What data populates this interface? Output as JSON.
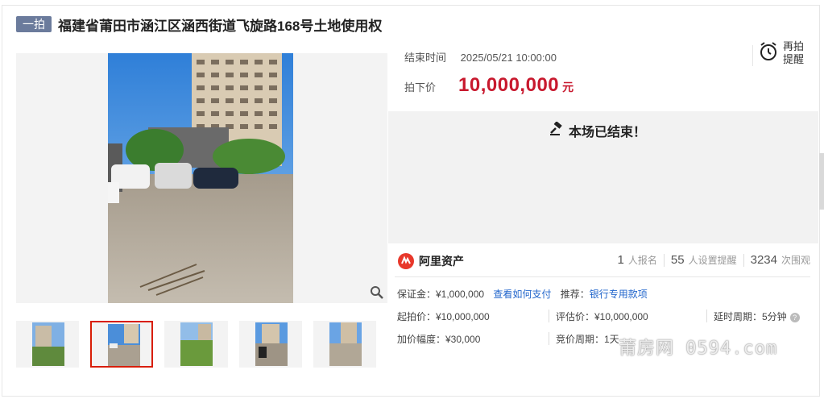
{
  "header": {
    "badge": "一拍",
    "title": "福建省莆田市涵江区涵西街道飞旋路168号土地使用权"
  },
  "auction": {
    "end_time_label": "结束时间",
    "end_time": "2025/05/21 10:00:00",
    "price_label": "拍下价",
    "price": "10,000,000",
    "price_unit": "元",
    "remind_line1": "再拍",
    "remind_line2": "提醒",
    "status": "本场已结束！"
  },
  "platform": {
    "name": "阿里资产",
    "signups": "1",
    "signups_label": "人报名",
    "reminders": "55",
    "reminders_label": "人设置提醒",
    "views": "3234",
    "views_label": "次围观"
  },
  "details": {
    "deposit": "保证金：¥1,000,000",
    "payment_link": "查看如何支付",
    "recommend_label": "推荐：",
    "recommend_link": "银行专用款项",
    "start_price": "起拍价：¥10,000,000",
    "appraisal": "评估价：¥10,000,000",
    "delay_period": "延时周期：5分钟",
    "increment": "加价幅度：¥30,000",
    "bid_period": "竞价周期：1天"
  },
  "gallery": {
    "active_index": 1,
    "thumb_count": 5
  },
  "watermark": "莆房网 0594.com",
  "colors": {
    "price": "#c8192e",
    "link": "#2266cc",
    "badge": "#6b7b9c",
    "active_thumb": "#d81e06"
  }
}
